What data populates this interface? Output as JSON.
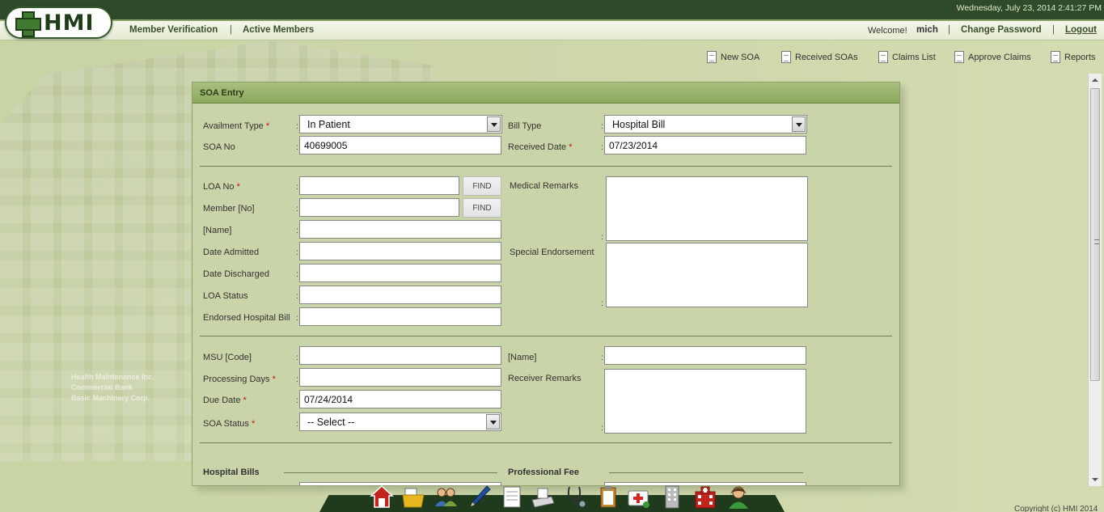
{
  "topbar": {
    "datetime": "Wednesday, July 23, 2014 2:41:27 PM"
  },
  "logo": {
    "text": "HMI"
  },
  "nav": {
    "member_verification": "Member Verification",
    "separator": "|",
    "active_members": "Active Members",
    "welcome_label": "Welcome!",
    "welcome_user": "mich",
    "change_password": "Change Password",
    "logout": "Logout"
  },
  "toolbar": {
    "new_soa": "New SOA",
    "received_soas": "Received SOAs",
    "claims_list": "Claims List",
    "approve_claims": "Approve Claims",
    "reports": "Reports"
  },
  "panel": {
    "title": "SOA Entry"
  },
  "form": {
    "colon": ":",
    "required_mark": "*",
    "availment_type": {
      "label": "Availment Type",
      "value": "In Patient"
    },
    "bill_type": {
      "label": "Bill Type",
      "value": "Hospital Bill"
    },
    "soa_no": {
      "label": "SOA No",
      "value": "40699005"
    },
    "received_date": {
      "label": "Received Date",
      "value": "07/23/2014"
    },
    "loa_no": {
      "label": "LOA No",
      "value": ""
    },
    "member_no": {
      "label": "Member [No]",
      "value": ""
    },
    "name": {
      "label": "[Name]",
      "value": ""
    },
    "date_admitted": {
      "label": "Date Admitted",
      "value": ""
    },
    "date_discharged": {
      "label": "Date Discharged",
      "value": ""
    },
    "loa_status": {
      "label": "LOA Status",
      "value": ""
    },
    "endorsed_hospital_bill": {
      "label": "Endorsed Hospital Bill",
      "value": ""
    },
    "find_label": "FIND",
    "medical_remarks": {
      "label": "Medical Remarks"
    },
    "special_endorsement": {
      "label": "Special Endorsement"
    },
    "msu_code": {
      "label": "MSU [Code]",
      "value": ""
    },
    "msu_name": {
      "label": "[Name]",
      "value": ""
    },
    "processing_days": {
      "label": "Processing Days",
      "value": ""
    },
    "receiver_remarks": {
      "label": "Receiver Remarks"
    },
    "due_date": {
      "label": "Due Date",
      "value": "07/24/2014"
    },
    "soa_status": {
      "label": "SOA Status",
      "value": "-- Select --"
    },
    "hospital_bills": "Hospital Bills",
    "professional_fee": "Professional Fee"
  },
  "background_sign": [
    "Health Maintenance Inc.",
    "Commercial Bank",
    "Basic Machinery Corp."
  ],
  "dock": [
    "home-icon",
    "folder-icon",
    "members-icon",
    "pen-icon",
    "document-icon",
    "calculator-icon",
    "stethoscope-icon",
    "clipboard-icon",
    "first-aid-kit-icon",
    "building-icon",
    "hospital-icon",
    "user-icon"
  ],
  "footer": {
    "copyright": "Copyright (c) HMI 2014"
  },
  "colors": {
    "topbar": "#2f4a2a",
    "panel_header": "#8ba85e",
    "background": "#ccd6a9",
    "required": "#d01010"
  }
}
